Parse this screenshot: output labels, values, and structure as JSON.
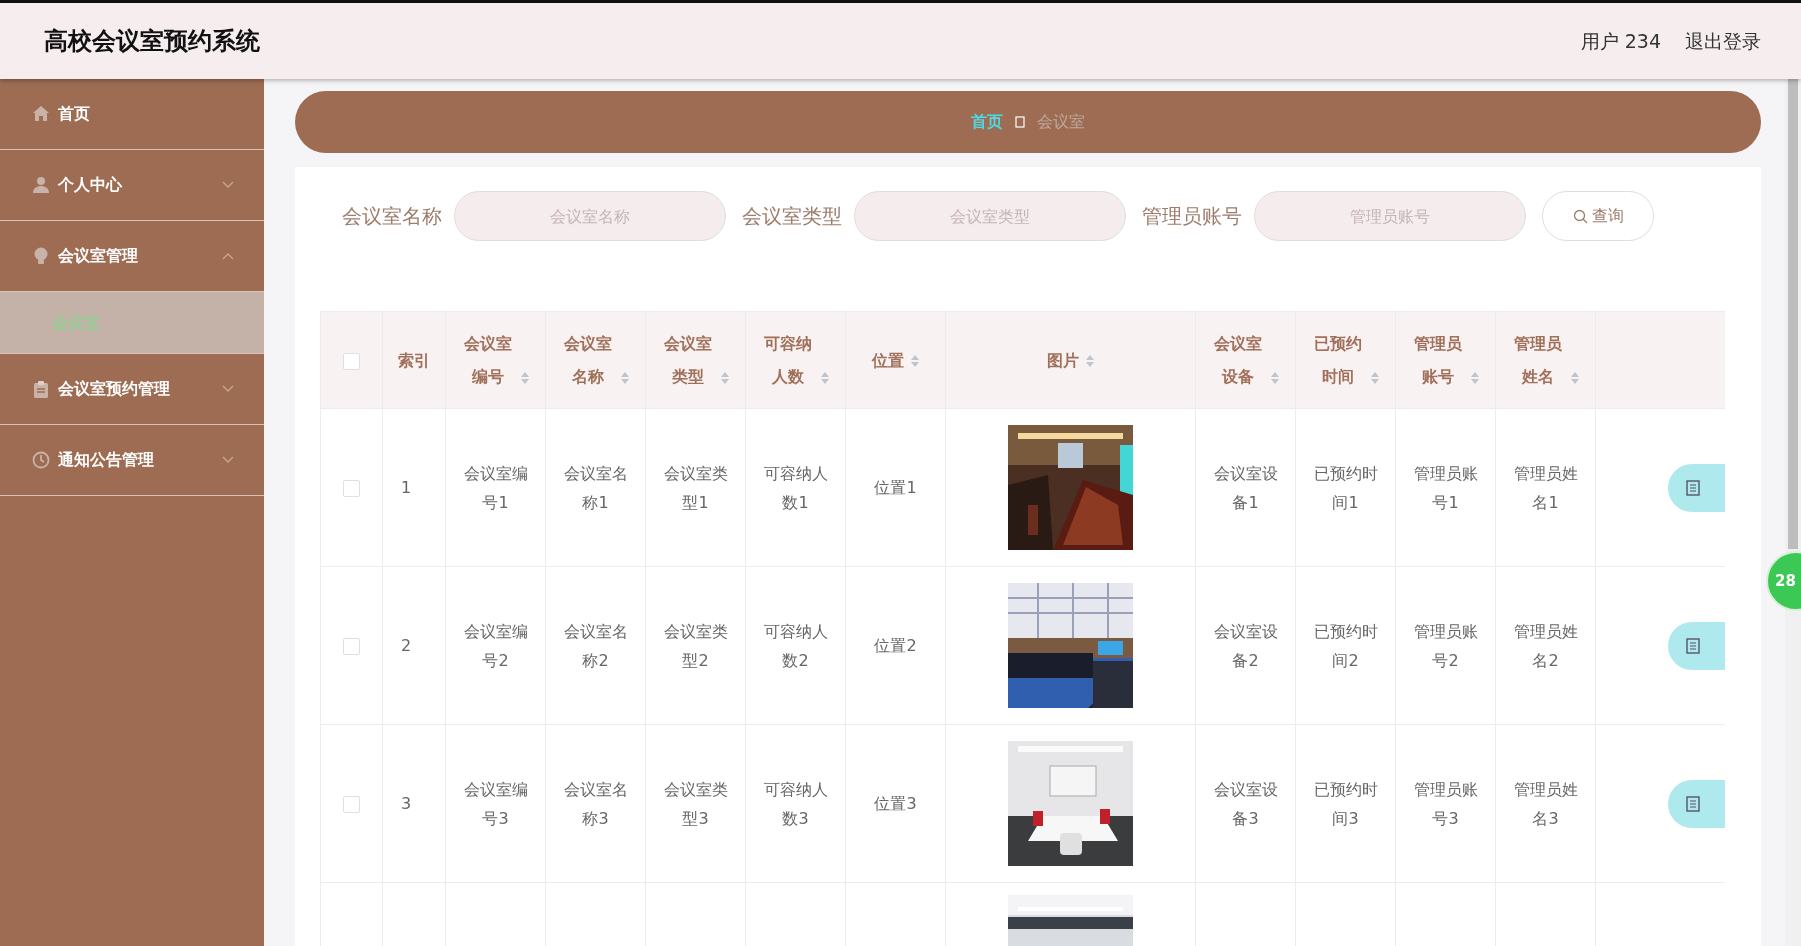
{
  "app": {
    "title": "高校会议室预约系统",
    "user": "用户 234",
    "logout": "退出登录"
  },
  "sidebar": {
    "items": [
      {
        "label": "首页",
        "selected": false
      },
      {
        "label": "个人中心",
        "selected": false,
        "expanded": false
      },
      {
        "label": "会议室管理",
        "selected": false,
        "expanded": true,
        "children": [
          {
            "label": "会议室",
            "selected": true
          }
        ]
      },
      {
        "label": "会议室预约管理",
        "selected": false,
        "expanded": false
      },
      {
        "label": "通知公告管理",
        "selected": false,
        "expanded": false
      }
    ]
  },
  "breadcrumb": [
    {
      "label": "首页",
      "current": false
    },
    {
      "label": "会议室",
      "current": true
    }
  ],
  "search": {
    "fields": [
      {
        "label": "会议室名称",
        "placeholder": "会议室名称"
      },
      {
        "label": "会议室类型",
        "placeholder": "会议室类型"
      },
      {
        "label": "管理员账号",
        "placeholder": "管理员账号"
      }
    ],
    "button": "查询"
  },
  "table": {
    "select_all_checked": false,
    "columns": [
      {
        "label": "索引",
        "sortable": false
      },
      {
        "label": "会议室编号",
        "sortable": true
      },
      {
        "label": "会议室名称",
        "sortable": true
      },
      {
        "label": "会议室类型",
        "sortable": true
      },
      {
        "label": "可容纳人数",
        "sortable": true
      },
      {
        "label": "位置",
        "sortable": true
      },
      {
        "label": "图片",
        "sortable": true
      },
      {
        "label": "会议室设备",
        "sortable": true
      },
      {
        "label": "已预约时间",
        "sortable": true
      },
      {
        "label": "管理员账号",
        "sortable": true
      },
      {
        "label": "管理员姓名",
        "sortable": true
      }
    ],
    "rows": [
      {
        "kind": "full",
        "checked": false,
        "cells": [
          "1",
          "会议室编号1",
          "会议室名称1",
          "会议室类型1",
          "可容纳人数1",
          "位置1",
          "会议室设备1",
          "已预约时间1",
          "管理员账号1",
          "管理员姓名1"
        ]
      },
      {
        "kind": "full",
        "checked": false,
        "cells": [
          "2",
          "会议室编号2",
          "会议室名称2",
          "会议室类型2",
          "可容纳人数2",
          "位置2",
          "会议室设备2",
          "已预约时间2",
          "管理员账号2",
          "管理员姓名2"
        ]
      },
      {
        "kind": "full",
        "checked": false,
        "cells": [
          "3",
          "会议室编号3",
          "会议室名称3",
          "会议室类型3",
          "可容纳人数3",
          "位置3",
          "会议室设备3",
          "已预约时间3",
          "管理员账号3",
          "管理员姓名3"
        ]
      },
      {
        "kind": "cut"
      }
    ]
  },
  "floating_badge": "28"
}
